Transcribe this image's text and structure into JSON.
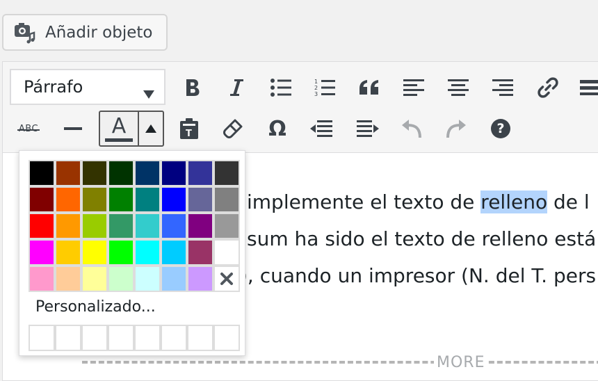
{
  "add_media": {
    "label": "Añadir objeto",
    "icon": "camera-music-icon"
  },
  "toolbar": {
    "format_select": {
      "value": "Párrafo"
    },
    "row1_buttons": [
      "bold-icon",
      "italic-icon",
      "bulleted-list-icon",
      "numbered-list-icon",
      "blockquote-icon",
      "align-left-icon",
      "align-center-icon",
      "align-right-icon",
      "link-icon",
      "toolbar-toggle-icon"
    ],
    "row2_buttons": [
      "strikethrough-icon",
      "horizontal-line-icon",
      "text-color-icon",
      "paste-as-text-icon",
      "clear-formatting-icon",
      "special-character-icon",
      "outdent-icon",
      "indent-icon",
      "undo-icon",
      "redo-icon",
      "help-icon"
    ],
    "strike_label": "ABC",
    "text_color_label": "A",
    "help_label": "?"
  },
  "content": {
    "line1_before": "implemente el texto de ",
    "line1_highlight": "relleno",
    "line1_after": " de l",
    "line2": "sum ha sido el texto de relleno está",
    "line3": "), cuando un impresor (N. del T. pers",
    "more_label": "MORE"
  },
  "color_picker": {
    "colors": [
      "#000000",
      "#993300",
      "#333300",
      "#003300",
      "#003366",
      "#000080",
      "#333399",
      "#333333",
      "#800000",
      "#FF6600",
      "#808000",
      "#008000",
      "#008080",
      "#0000FF",
      "#666699",
      "#808080",
      "#FF0000",
      "#FF9900",
      "#99CC00",
      "#339966",
      "#33CCCC",
      "#3366FF",
      "#800080",
      "#999999",
      "#FF00FF",
      "#FFCC00",
      "#FFFF00",
      "#00FF00",
      "#00FFFF",
      "#00CCFF",
      "#993366",
      "#FFFFFF",
      "#FF99CC",
      "#FFCC99",
      "#FFFF99",
      "#CCFFCC",
      "#CCFFFF",
      "#99CCFF",
      "#CC99FF"
    ],
    "remove_icon": "remove-color-icon",
    "custom_label": "Personalizado...",
    "custom_slots": 8
  }
}
